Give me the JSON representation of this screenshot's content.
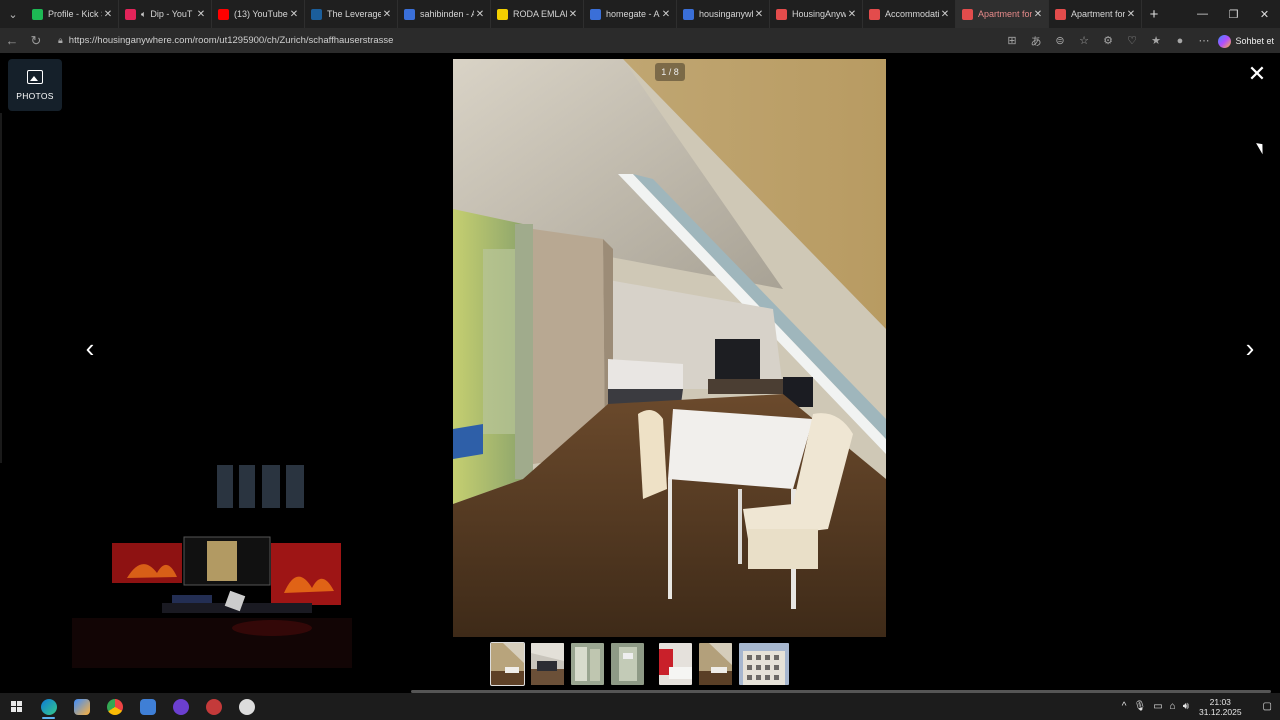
{
  "browser": {
    "tabs": [
      {
        "title": "Profile - Kick St",
        "favicon": "kick-icon",
        "color": "#1db954",
        "active": false
      },
      {
        "title": "Dip - YouT",
        "favicon": "music-icon",
        "color": "#e2245a",
        "active": false,
        "muted_icon": "speaker-icon"
      },
      {
        "title": "(13) YouTube",
        "favicon": "youtube-icon",
        "color": "#ff0000",
        "active": false
      },
      {
        "title": "The Leverage G",
        "favicon": "steam-icon",
        "color": "#1b5e9b",
        "active": false
      },
      {
        "title": "sahibinden - Ar",
        "favicon": "search-icon",
        "color": "#3a6fd8",
        "active": false
      },
      {
        "title": "RODA EMLAKÇ",
        "favicon": "s-icon",
        "color": "#f3d000",
        "active": false
      },
      {
        "title": "homegate - Ar",
        "favicon": "search-icon",
        "color": "#3a6fd8",
        "active": false
      },
      {
        "title": "housinganywh",
        "favicon": "search-icon",
        "color": "#3a6fd8",
        "active": false
      },
      {
        "title": "HousingAnyw",
        "favicon": "housinganywhere-icon",
        "color": "#e34c4c",
        "active": false
      },
      {
        "title": "Accommodati",
        "favicon": "housinganywhere-icon",
        "color": "#e34c4c",
        "active": false
      },
      {
        "title": "Apartment for",
        "favicon": "housinganywhere-icon",
        "color": "#e34c4c",
        "active": true
      },
      {
        "title": "Apartment for",
        "favicon": "housinganywhere-icon",
        "color": "#e34c4c",
        "active": false
      }
    ],
    "url": "https://housinganywhere.com/room/ut1295900/ch/Zurich/schaffhauserstrasse",
    "copilot_label": "Sohbet et"
  },
  "viewer": {
    "photos_label": "PHOTOS",
    "counter": "1 / 8",
    "close_icon": "close-icon",
    "prev_icon": "chevron-left-icon",
    "next_icon": "chevron-right-icon",
    "thumbnails": [
      "room-table",
      "room-attic",
      "room-bathroom",
      "room-shower",
      "room-bed-red",
      "room-table-2",
      "building-exterior"
    ]
  },
  "taskbar": {
    "apps": [
      "start",
      "edge",
      "copilot",
      "chrome",
      "app-blue",
      "app-purple",
      "app-red",
      "app-white"
    ],
    "time": "21:03",
    "date": "31.12.2025"
  }
}
